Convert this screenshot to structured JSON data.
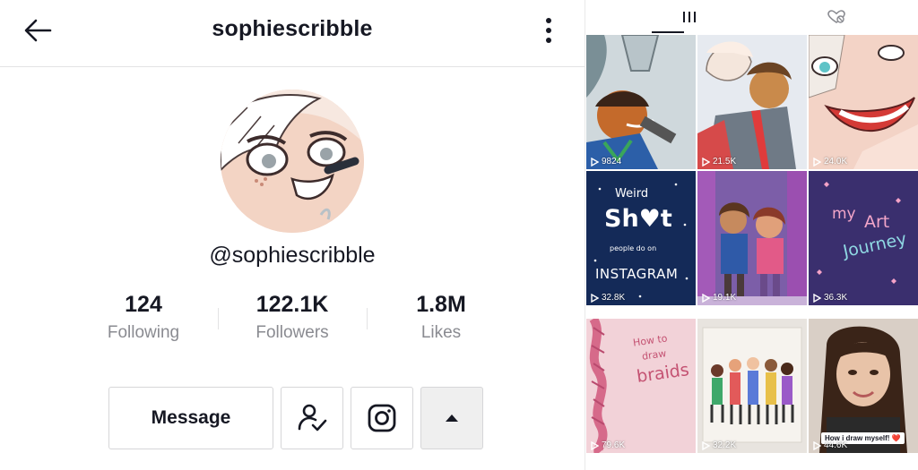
{
  "header": {
    "title": "sophiescribble"
  },
  "profile": {
    "handle": "@sophiescribble",
    "stats": [
      {
        "value": "124",
        "label": "Following"
      },
      {
        "value": "122.1K",
        "label": "Followers"
      },
      {
        "value": "1.8M",
        "label": "Likes"
      }
    ]
  },
  "actions": {
    "message_label": "Message"
  },
  "tabs": [
    {
      "name": "videos",
      "icon": "grid-icon",
      "selected": true
    },
    {
      "name": "liked",
      "icon": "liked-heart-hidden-icon",
      "selected": false
    }
  ],
  "videos": [
    {
      "views": "9824"
    },
    {
      "views": "21.5K"
    },
    {
      "views": "24.0K"
    },
    {
      "views": "32.8K",
      "text": [
        "Weird",
        "Sh♥t",
        "people do on",
        "INSTAGRAM"
      ]
    },
    {
      "views": "19.1K"
    },
    {
      "views": "36.3K",
      "text": [
        "my",
        "Art",
        "Journey"
      ]
    },
    {
      "views": "79.6K",
      "text": [
        "How to",
        "draw",
        "braids"
      ]
    },
    {
      "views": "32.2K"
    },
    {
      "views": "44.6K",
      "caption": "How i draw myself! ❤️"
    }
  ],
  "colors": {
    "text": "#161823",
    "muted": "#8a8b91",
    "border": "#d6d6d8"
  }
}
